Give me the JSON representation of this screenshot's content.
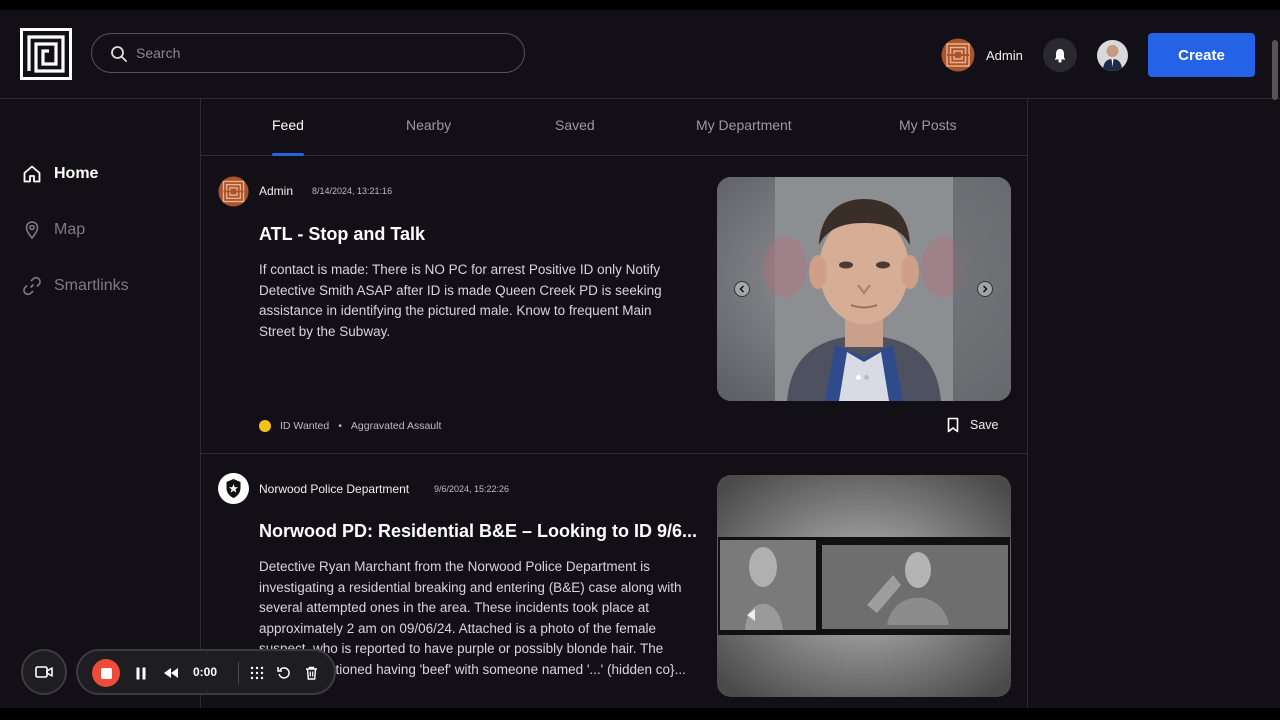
{
  "header": {
    "search_placeholder": "Search",
    "user_name": "Admin",
    "create_label": "Create"
  },
  "sidebar": {
    "items": [
      {
        "label": "Home",
        "icon": "home-icon",
        "active": true
      },
      {
        "label": "Map",
        "icon": "map-pin-icon",
        "active": false
      },
      {
        "label": "Smartlinks",
        "icon": "link-icon",
        "active": false
      }
    ]
  },
  "tabs": [
    {
      "label": "Feed",
      "active": true
    },
    {
      "label": "Nearby",
      "active": false
    },
    {
      "label": "Saved",
      "active": false
    },
    {
      "label": "My Department",
      "active": false
    },
    {
      "label": "My Posts",
      "active": false
    }
  ],
  "posts": [
    {
      "author": "Admin",
      "timestamp": "8/14/2024, 13:21:16",
      "title": "ATL - Stop and Talk",
      "body": "If contact is made: There is NO PC for arrest Positive ID only Notify Detective Smith ASAP after ID is made Queen Creek PD is seeking assistance in identifying the pictured male. Know to frequent Main Street by the Subway.",
      "status": "ID Wanted",
      "status_color": "#f2c21b",
      "category": "Aggravated Assault",
      "save_label": "Save"
    },
    {
      "author": "Norwood Police Department",
      "timestamp": "9/6/2024, 15:22:26",
      "title": "Norwood PD: Residential B&E – Looking to ID 9/6...",
      "body": "Detective Ryan Marchant from the Norwood Police Department is investigating a residential breaking and entering (B&E) case along with several attempted ones in the area. These incidents took place at approximately 2 am on 09/06/24. Attached is a photo of the female suspect, who is reported to have purple or possibly blonde hair. The suspect mentioned having 'beef' with someone named '...' (hidden co}..."
    }
  ],
  "recorder": {
    "time": "0:00"
  },
  "colors": {
    "accent": "#2462e8",
    "background": "#121016",
    "record": "#ee4b3b"
  }
}
